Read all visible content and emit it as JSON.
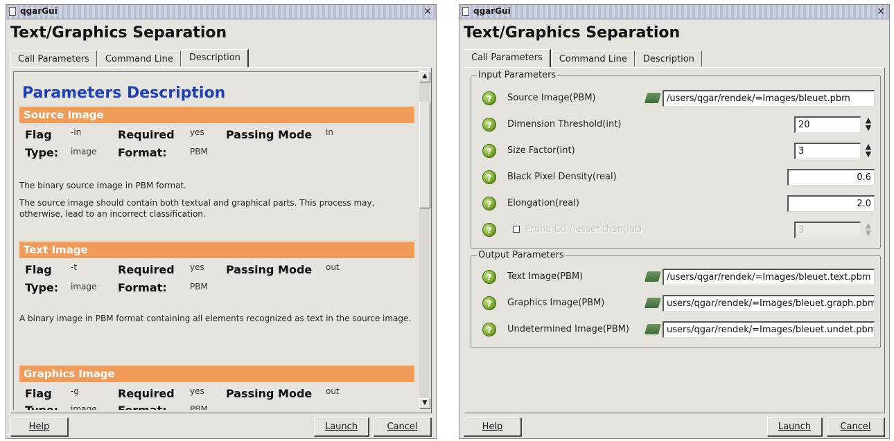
{
  "left_window": {
    "title": "qgarGui",
    "heading": "Text/Graphics Separation",
    "tabs": [
      "Call Parameters",
      "Command Line",
      "Description"
    ],
    "active_tab": "Description",
    "description": {
      "title": "Parameters Description",
      "sections": [
        {
          "name": "Source Image",
          "flag_label": "Flag",
          "flag": "-in",
          "required_label": "Required",
          "required": "yes",
          "mode_label": "Passing Mode",
          "mode": "in",
          "type_label": "Type:",
          "type": "image",
          "format_label": "Format:",
          "format": "PBM",
          "paragraphs": [
            "The binary source image in PBM format.",
            "The source image should contain both textual and graphical parts. This process may, otherwise, lead to an incorrect classification."
          ]
        },
        {
          "name": "Text Image",
          "flag_label": "Flag",
          "flag": "-t",
          "required_label": "Required",
          "required": "yes",
          "mode_label": "Passing Mode",
          "mode": "out",
          "type_label": "Type:",
          "type": "image",
          "format_label": "Format:",
          "format": "PBM",
          "paragraphs": [
            "A binary image in PBM format containing all elements recognized as text in the source image."
          ]
        },
        {
          "name": "Graphics Image",
          "flag_label": "Flag",
          "flag": "-g",
          "required_label": "Required",
          "required": "yes",
          "mode_label": "Passing Mode",
          "mode": "out",
          "type_label": "Type:",
          "type": "image",
          "format_label": "Format:",
          "format": "PBM",
          "paragraphs": []
        }
      ]
    },
    "buttons": {
      "help": "Help",
      "launch": "Launch",
      "cancel": "Cancel"
    }
  },
  "right_window": {
    "title": "qgarGui",
    "heading": "Text/Graphics Separation",
    "tabs": [
      "Call Parameters",
      "Command Line",
      "Description"
    ],
    "active_tab": "Call Parameters",
    "input_group": {
      "title": "Input Parameters",
      "params": [
        {
          "label": "Source Image(PBM)",
          "kind": "file",
          "value": "/users/qgar/rendek/=Images/bleuet.pbm"
        },
        {
          "label": "Dimension Threshold(int)",
          "kind": "spin",
          "value": "20"
        },
        {
          "label": "Size Factor(int)",
          "kind": "spin",
          "value": "3"
        },
        {
          "label": "Black Pixel Density(real)",
          "kind": "real",
          "value": "0.6"
        },
        {
          "label": "Elongation(real)",
          "kind": "real",
          "value": "2.0"
        },
        {
          "label": "Prune CC (lesser than(int)",
          "kind": "spin-disabled",
          "value": "3",
          "checked": false
        }
      ]
    },
    "output_group": {
      "title": "Output Parameters",
      "params": [
        {
          "label": "Text Image(PBM)",
          "value": "/users/qgar/rendek/=Images/bleuet.text.pbm"
        },
        {
          "label": "Graphics Image(PBM)",
          "value": "users/qgar/rendek/=Images/bleuet.graph.pbm"
        },
        {
          "label": "Undetermined Image(PBM)",
          "value": "users/qgar/rendek/=Images/bleuet.undet.pbm"
        }
      ]
    },
    "buttons": {
      "help": "Help",
      "launch": "Launch",
      "cancel": "Cancel"
    }
  },
  "icons": {
    "help": "question-mark-icon",
    "file": "folder-open-icon",
    "close": "close-icon"
  },
  "colors": {
    "section_header": "#f19b59",
    "description_title": "#1c3fb3",
    "window_bg": "#e4e3de"
  }
}
